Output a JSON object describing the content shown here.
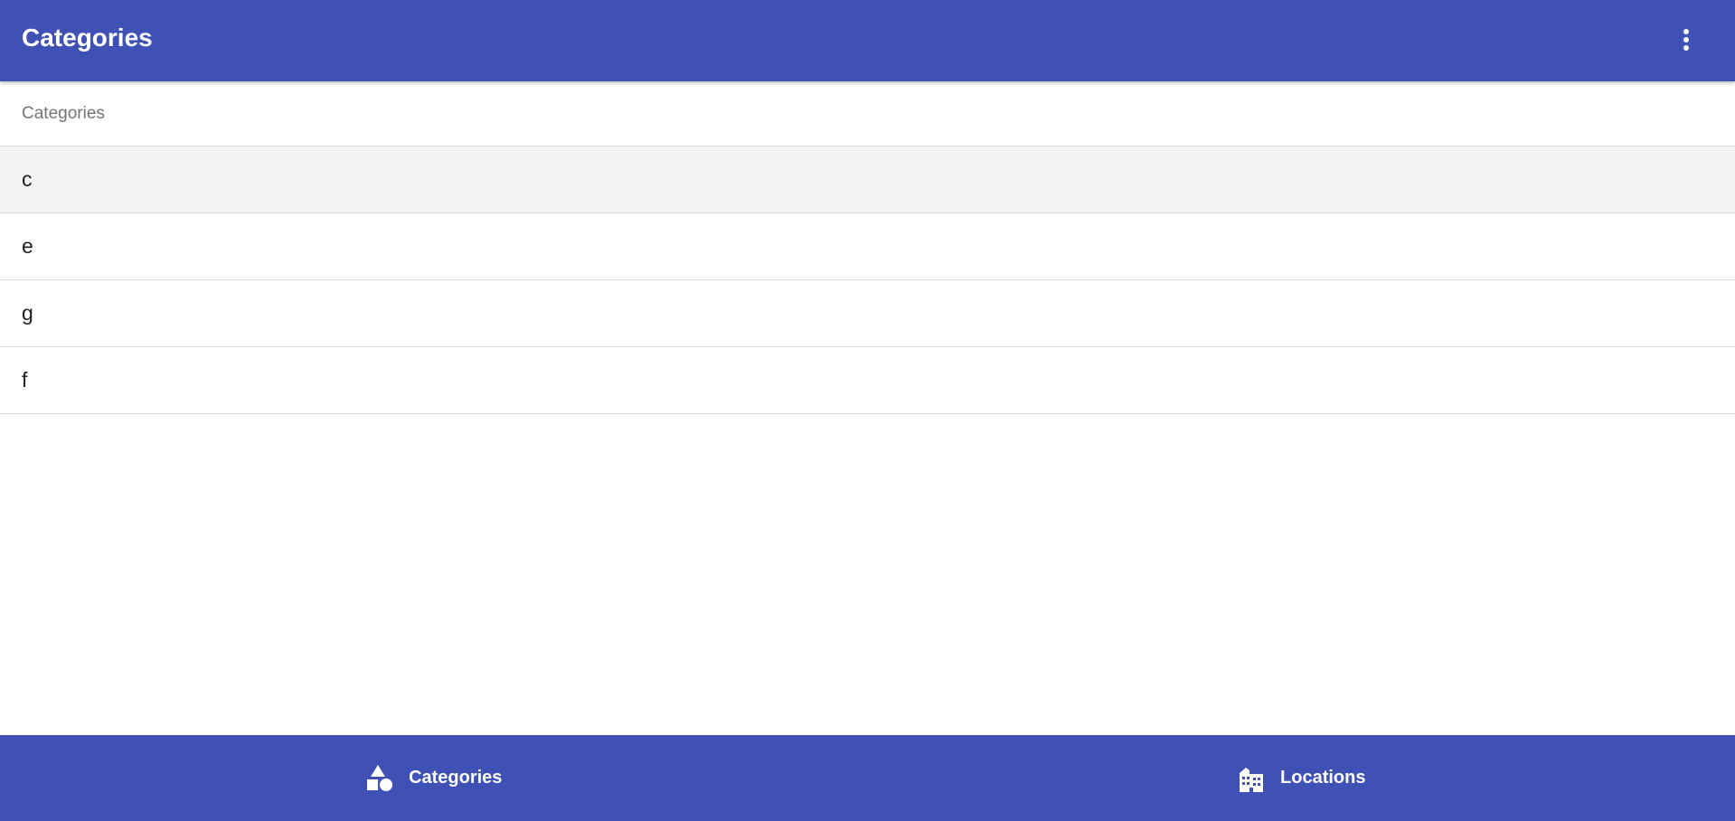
{
  "app_bar": {
    "title": "Categories",
    "overflow_icon": "more-vert-icon"
  },
  "list": {
    "subheader": "Categories",
    "items": [
      {
        "label": "c",
        "selected": true
      },
      {
        "label": "e",
        "selected": false
      },
      {
        "label": "g",
        "selected": false
      },
      {
        "label": "f",
        "selected": false
      }
    ]
  },
  "bottom_nav": {
    "items": [
      {
        "label": "Categories",
        "icon": "shapes-icon"
      },
      {
        "label": "Locations",
        "icon": "buildings-icon"
      }
    ]
  },
  "colors": {
    "primary": "#3f51b5",
    "on_primary": "#ffffff",
    "selected_row": "#f4f4f4",
    "divider": "#dcdcdc",
    "subheader_text": "#757575",
    "item_text": "#212121"
  }
}
